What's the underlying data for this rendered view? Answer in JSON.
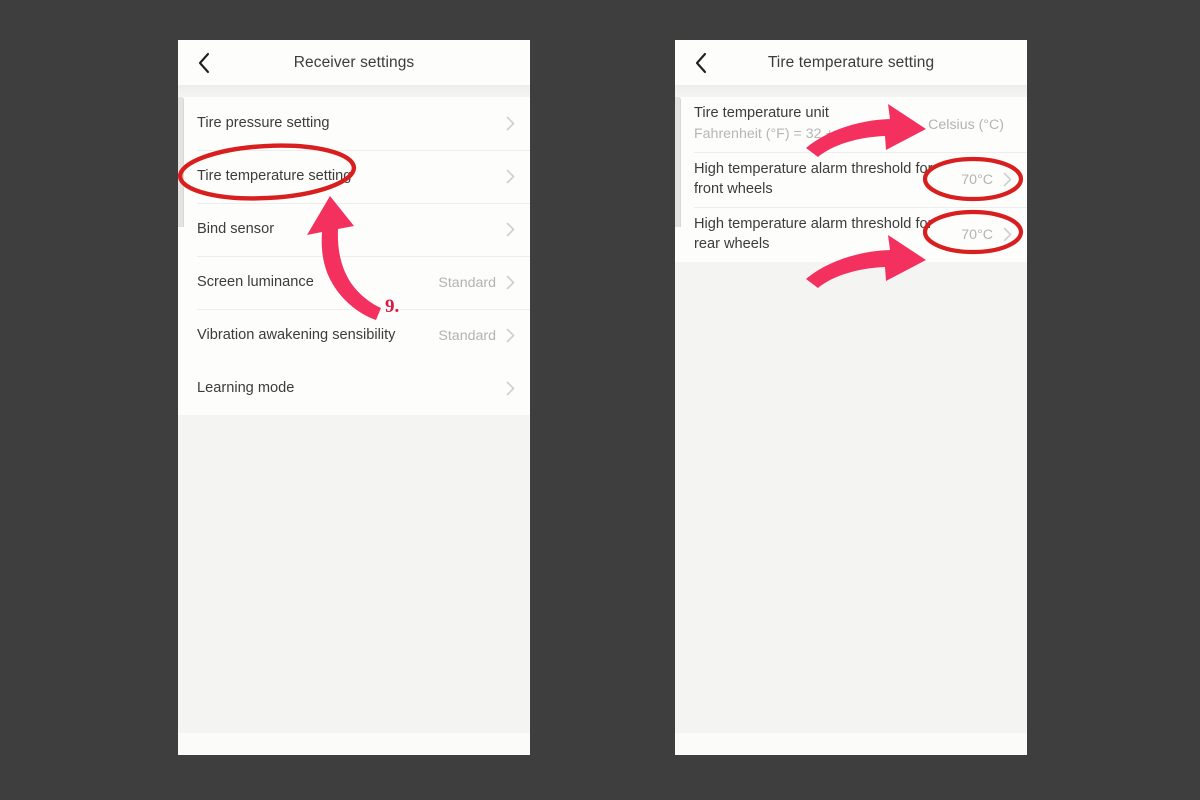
{
  "background_color": "#3e3e3e",
  "annotation": {
    "step_number": "9.",
    "highlight_color": "#d81e1e",
    "arrow_color": "#f4305f",
    "number_color": "#d61a45"
  },
  "screens": [
    {
      "id": "receiver-settings",
      "header": {
        "title": "Receiver settings",
        "back_icon": "chevron-left-icon"
      },
      "rows": [
        {
          "label": "Tire pressure setting",
          "value": "",
          "chevron": "chevron-right-icon",
          "highlighted": false
        },
        {
          "label": "Tire temperature setting",
          "value": "",
          "chevron": "chevron-right-icon",
          "highlighted": true
        },
        {
          "label": "Bind sensor",
          "value": "",
          "chevron": "chevron-right-icon",
          "highlighted": false
        },
        {
          "label": "Screen luminance",
          "value": "Standard",
          "chevron": "chevron-right-icon",
          "highlighted": false
        },
        {
          "label": "Vibration awakening sensibility",
          "value": "Standard",
          "chevron": "chevron-right-icon",
          "highlighted": false
        }
      ],
      "rows_group2": [
        {
          "label": "Learning mode",
          "value": "",
          "chevron": "chevron-right-icon",
          "highlighted": false
        }
      ]
    },
    {
      "id": "tire-temperature-setting",
      "header": {
        "title": "Tire temperature setting",
        "back_icon": "chevron-left-icon"
      },
      "rows": [
        {
          "label": "Tire temperature unit",
          "subtitle": "Fahrenheit (°F) = 32 +",
          "value": "Celsius (°C)",
          "chevron": "",
          "highlighted": false
        },
        {
          "label": "High temperature alarm threshold for front wheels",
          "subtitle": "",
          "value": "70°C",
          "chevron": "chevron-right-icon",
          "highlighted": true
        },
        {
          "label": "High temperature alarm threshold for rear wheels",
          "subtitle": "",
          "value": "70°C",
          "chevron": "chevron-right-icon",
          "highlighted": true
        }
      ]
    }
  ]
}
